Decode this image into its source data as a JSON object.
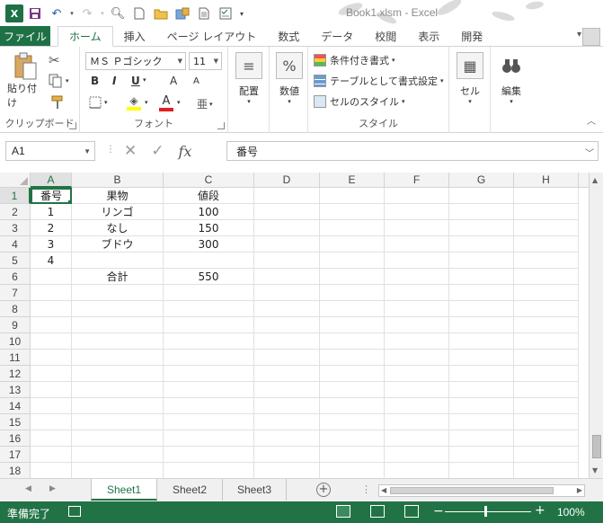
{
  "title": "Book1.xlsm - Excel",
  "qat": {
    "undo_icon": "undo-icon",
    "redo_icon": "redo-icon"
  },
  "tabs": [
    "ファイル",
    "ホーム",
    "挿入",
    "ページ レイアウト",
    "数式",
    "データ",
    "校閲",
    "表示",
    "開発"
  ],
  "ribbon": {
    "clipboard": {
      "paste": "貼り付け",
      "label": "クリップボード"
    },
    "font": {
      "name": "ＭＳ Ｐゴシック",
      "size": "11",
      "bold": "B",
      "italic": "I",
      "underline": "U",
      "grow": "A",
      "shrink": "A",
      "label": "フォント"
    },
    "alignment": {
      "label": "配置"
    },
    "number": {
      "symbol": "%",
      "label": "数値"
    },
    "styles": {
      "conditional": "条件付き書式",
      "table": "テーブルとして書式設定",
      "cell_style": "セルのスタイル",
      "label": "スタイル"
    },
    "cells": {
      "label": "セル"
    },
    "editing": {
      "label": "編集"
    }
  },
  "formula_bar": {
    "name_box": "A1",
    "fx": "fx",
    "content": "番号"
  },
  "columns": [
    "A",
    "B",
    "C",
    "D",
    "E",
    "F",
    "G",
    "H"
  ],
  "rows": [
    "1",
    "2",
    "3",
    "4",
    "5",
    "6",
    "7",
    "8",
    "9",
    "10",
    "11",
    "12",
    "13",
    "14",
    "15",
    "16",
    "17",
    "18"
  ],
  "cells": {
    "A1": "番号",
    "B1": "果物",
    "C1": "値段",
    "A2": "1",
    "B2": "リンゴ",
    "C2": "100",
    "A3": "2",
    "B3": "なし",
    "C3": "150",
    "A4": "3",
    "B4": "ブドウ",
    "C4": "300",
    "A5": "4",
    "B6": "合計",
    "C6": "550"
  },
  "sheets": [
    "Sheet1",
    "Sheet2",
    "Sheet3"
  ],
  "status": {
    "ready": "準備完了",
    "zoom": "100%"
  },
  "colors": {
    "excel_green": "#217346",
    "file_tab": "#1e7145"
  }
}
